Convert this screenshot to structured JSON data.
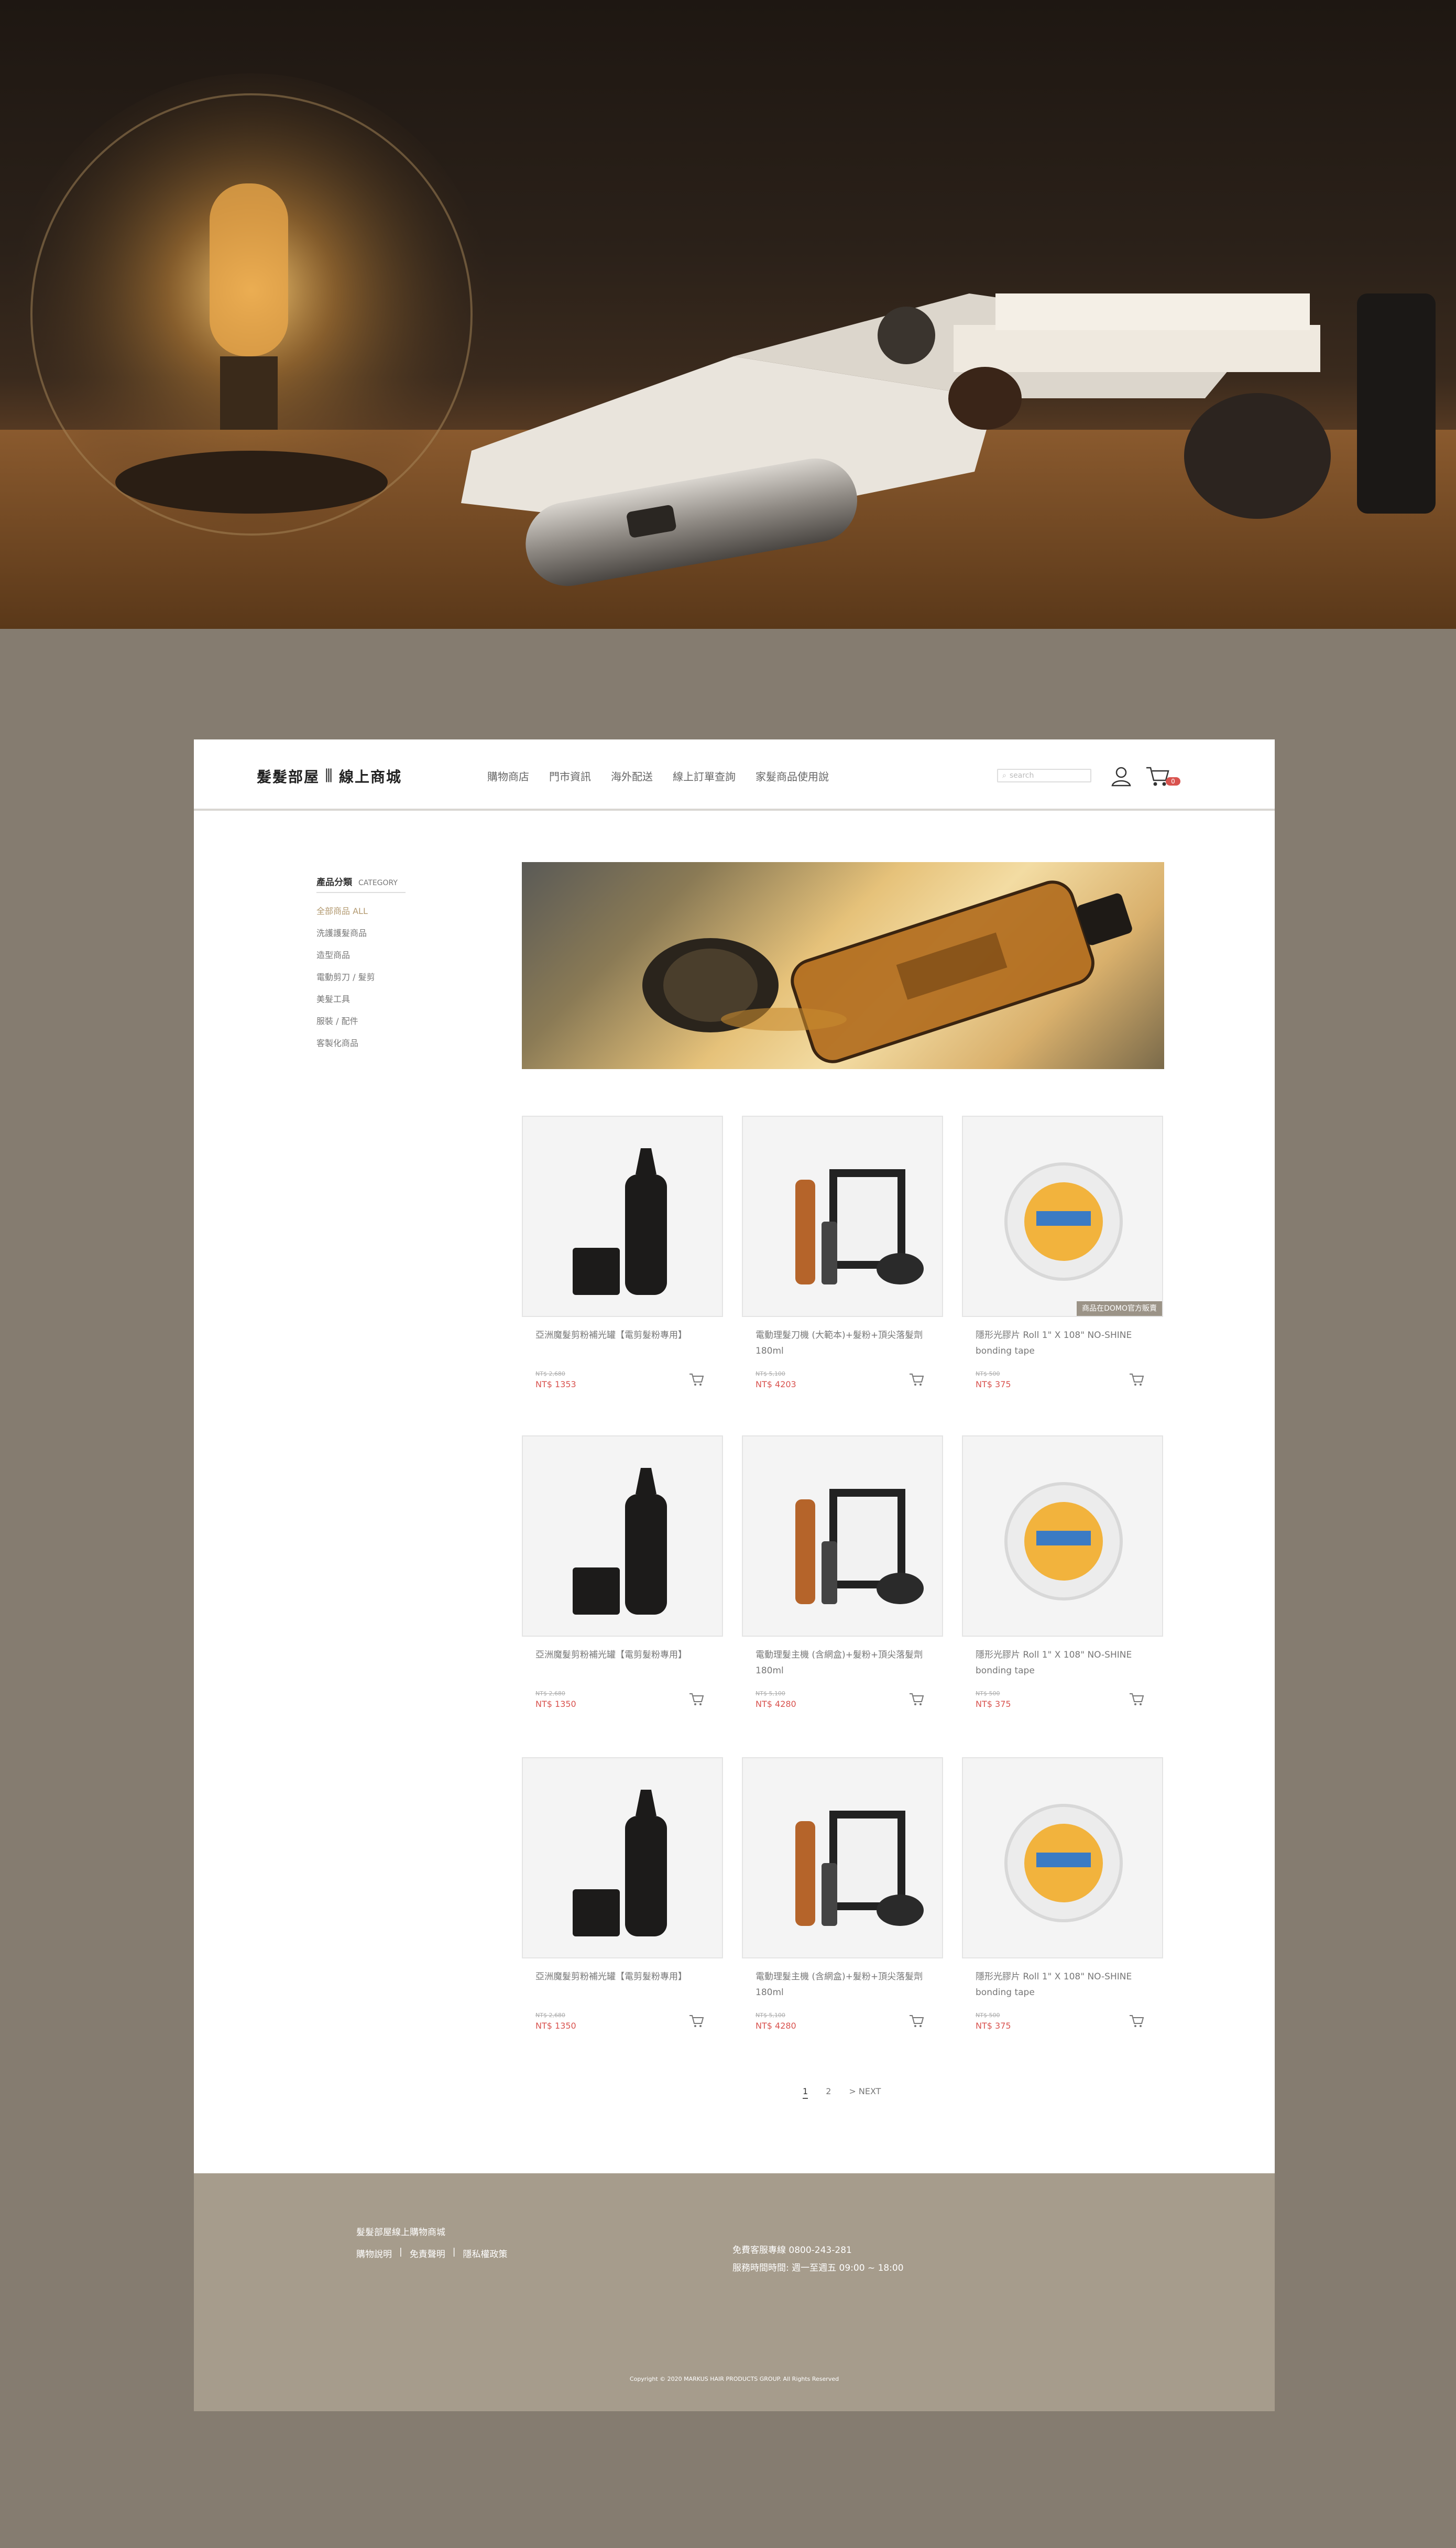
{
  "header": {
    "logo_text": "髮髮部屋",
    "logo_sub": "線上商城",
    "nav": [
      "購物商店",
      "門市資訊",
      "海外配送",
      "線上訂單查詢",
      "家髮商品使用說"
    ],
    "search_placeholder": "search",
    "cart_count": "0"
  },
  "sidebar": {
    "title_zh": "產品分類",
    "title_en": "CATEGORY",
    "items": [
      "全部商品 ALL",
      "洗護護髮商品",
      "造型商品",
      "電動剪刀 / 髮剪",
      "美髮工具",
      "服裝 / 配件",
      "客製化商品"
    ]
  },
  "products": [
    {
      "name": "亞洲魔髮剪粉補光罐【電剪髮粉專用】",
      "old_price": "NT$ 2,680",
      "price": "NT$ 1353",
      "tag": ""
    },
    {
      "name": "電動理髮刀機 (大範本)+髮粉+頂尖落髮劑 180ml",
      "old_price": "NT$ 5,100",
      "price": "NT$ 4203",
      "tag": ""
    },
    {
      "name": "隱形光膠片 Roll 1\" X 108\" NO-SHINE bonding tape",
      "old_price": "NT$ 500",
      "price": "NT$ 375",
      "tag": "商品在DOMO官方販賣"
    },
    {
      "name": "亞洲魔髮剪粉補光罐【電剪髮粉專用】",
      "old_price": "NT$ 2,680",
      "price": "NT$ 1350",
      "tag": ""
    },
    {
      "name": "電動理髮主機 (含網盒)+髮粉+頂尖落髮劑 180ml",
      "old_price": "NT$ 5,100",
      "price": "NT$ 4280",
      "tag": ""
    },
    {
      "name": "隱形光膠片 Roll 1\" X 108\" NO-SHINE bonding tape",
      "old_price": "NT$ 500",
      "price": "NT$ 375",
      "tag": ""
    },
    {
      "name": "亞洲魔髮剪粉補光罐【電剪髮粉專用】",
      "old_price": "NT$ 2,680",
      "price": "NT$ 1350",
      "tag": ""
    },
    {
      "name": "電動理髮主機 (含網盒)+髮粉+頂尖落髮劑 180ml",
      "old_price": "NT$ 5,100",
      "price": "NT$ 4280",
      "tag": ""
    },
    {
      "name": "隱形光膠片 Roll 1\" X 108\" NO-SHINE bonding tape",
      "old_price": "NT$ 500",
      "price": "NT$ 375",
      "tag": ""
    }
  ],
  "pagination": {
    "current": "1",
    "page2": "2",
    "next": "> NEXT"
  },
  "footer": {
    "title": "髮髮部屋線上購物商城",
    "links": [
      "購物說明",
      "|",
      "免責聲明",
      "|",
      "隱私權政策"
    ],
    "phone": "免費客服專線 0800-243-281",
    "hours": "服務時間時間: 週一至週五  09:00 ~ 18:00",
    "copyright": "Copyright © 2020 MARKUS HAIR PRODUCTS GROUP. All Rights Reserved"
  },
  "colors": {
    "background": "#857c70",
    "footer": "#a69c8c",
    "price": "#d9534f",
    "accent": "#b39a71"
  }
}
